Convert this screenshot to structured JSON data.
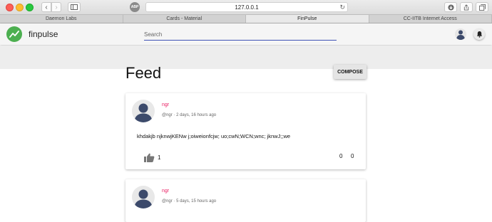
{
  "browser": {
    "url": "127.0.0.1",
    "tabs": [
      {
        "label": "Daemon Labs",
        "active": false
      },
      {
        "label": "Cards - Material",
        "active": false
      },
      {
        "label": "FinPulse",
        "active": true
      },
      {
        "label": "CC-IITB Internet Access",
        "active": false
      }
    ]
  },
  "header": {
    "brand": "finpulse",
    "search_placeholder": "Search",
    "accent": "#3f51b5",
    "logo_color": "#4caf50"
  },
  "feed": {
    "title": "Feed",
    "compose_label": "COMPOSE",
    "posts": [
      {
        "author": "ngr",
        "meta": "@ngr · 2 days, 16 hours ago",
        "text": "khdakjb njknwjKENw j;oiweionfcjw; uo;cwN;WCN;wnc; jknwJ;;we",
        "likes": "1",
        "stat_a": "0",
        "stat_b": "0"
      },
      {
        "author": "ngr",
        "meta": "@ngr · 5 days, 15 hours ago"
      }
    ]
  }
}
